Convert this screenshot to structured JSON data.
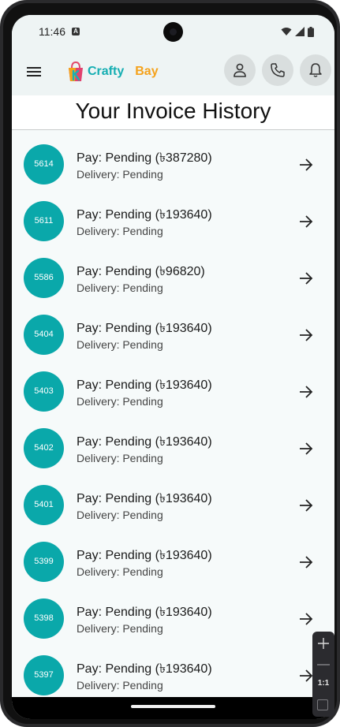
{
  "status_bar": {
    "time": "11:46",
    "notification_badge": "A",
    "icons": [
      "wifi-icon",
      "signal-icon",
      "battery-icon"
    ]
  },
  "app_bar": {
    "logo_word1": "Crafty",
    "logo_word2": "Bay",
    "actions": [
      "profile-icon",
      "phone-icon",
      "bell-icon"
    ]
  },
  "page": {
    "title": "Your Invoice History"
  },
  "invoices": [
    {
      "id": "5614",
      "pay": "Pay: Pending (৳387280)",
      "delivery": "Delivery: Pending"
    },
    {
      "id": "5611",
      "pay": "Pay: Pending (৳193640)",
      "delivery": "Delivery: Pending"
    },
    {
      "id": "5586",
      "pay": "Pay: Pending (৳96820)",
      "delivery": "Delivery: Pending"
    },
    {
      "id": "5404",
      "pay": "Pay: Pending (৳193640)",
      "delivery": "Delivery: Pending"
    },
    {
      "id": "5403",
      "pay": "Pay: Pending (৳193640)",
      "delivery": "Delivery: Pending"
    },
    {
      "id": "5402",
      "pay": "Pay: Pending (৳193640)",
      "delivery": "Delivery: Pending"
    },
    {
      "id": "5401",
      "pay": "Pay: Pending (৳193640)",
      "delivery": "Delivery: Pending"
    },
    {
      "id": "5399",
      "pay": "Pay: Pending (৳193640)",
      "delivery": "Delivery: Pending"
    },
    {
      "id": "5398",
      "pay": "Pay: Pending (৳193640)",
      "delivery": "Delivery: Pending"
    },
    {
      "id": "5397",
      "pay": "Pay: Pending (৳193640)",
      "delivery": "Delivery: Pending"
    }
  ],
  "emulator_zoom": {
    "label": "1:1"
  },
  "colors": {
    "accent": "#0aa8aa",
    "brand_secondary": "#f5a21b",
    "app_bar_bg": "#eef4f4",
    "list_bg": "#f6fafa"
  }
}
